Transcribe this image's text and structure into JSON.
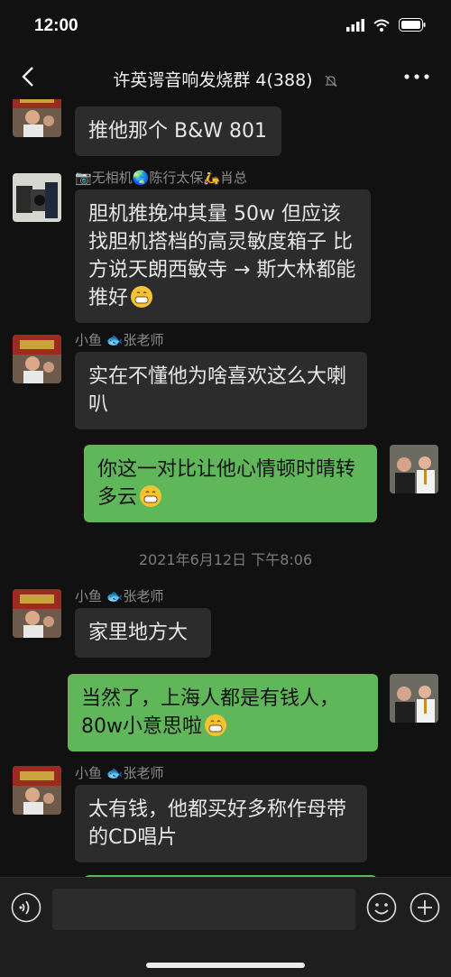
{
  "status": {
    "time": "12:00"
  },
  "header": {
    "title": "许英谔音响发烧群 4(388)"
  },
  "timestamp": "2021年6月12日 下午8:06",
  "messages": [
    {
      "text": "推他那个 B&W 801"
    },
    {
      "sender": "📷无相机🌏陈行太保🛵肖总",
      "text": "胆机推挽冲其量 50w 但应该找胆机搭档的高灵敏度箱子 比方说天朗西敏寺 → 斯大林都能推好"
    },
    {
      "sender": "小鱼 🐟张老师",
      "text": "实在不懂他为啥喜欢这么大喇叭"
    },
    {
      "text": "你这一对比让他心情顿时晴转多云"
    },
    {
      "sender": "小鱼 🐟张老师",
      "text": "家里地方大"
    },
    {
      "text": "当然了，上海人都是有钱人，80w小意思啦"
    },
    {
      "sender": "小鱼 🐟张老师",
      "text": "太有钱，他都买好多称作母带的CD唱片"
    }
  ],
  "colors": {
    "incoming": "#2c2c2c",
    "outgoing": "#5fb75a",
    "background": "#111111"
  },
  "icons": [
    "back-arrow-icon",
    "mute-bell-icon",
    "more-dots-icon",
    "voice-icon",
    "emoji-icon",
    "plus-icon"
  ]
}
